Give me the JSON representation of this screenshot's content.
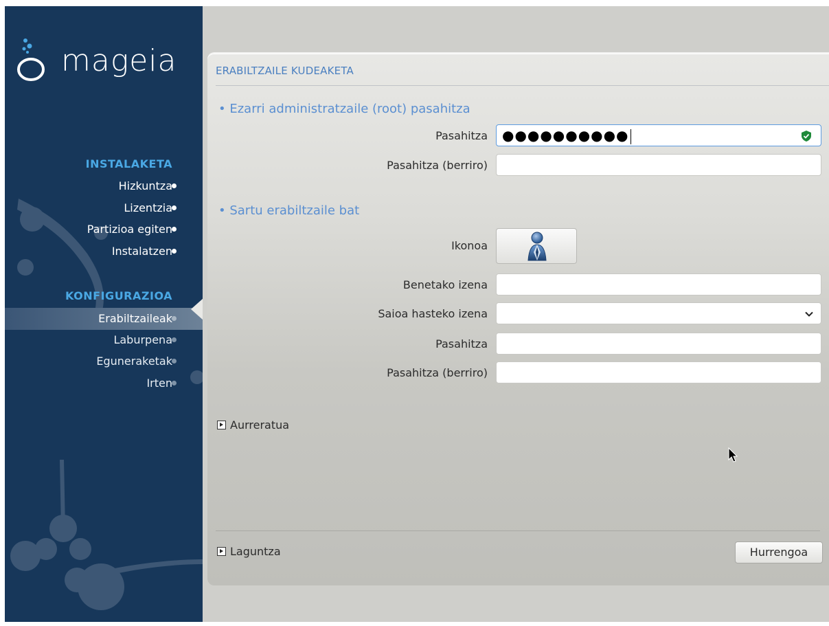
{
  "logo": {
    "text": "mageia"
  },
  "sidebar": {
    "install_title": "INSTALAKETA",
    "install_items": [
      {
        "label": "Hizkuntza"
      },
      {
        "label": "Lizentzia"
      },
      {
        "label": "Partizioa egiten"
      },
      {
        "label": "Instalatzen"
      }
    ],
    "config_title": "KONFIGURAZIOA",
    "config_items": [
      {
        "label": "Erabiltzaileak",
        "active": true
      },
      {
        "label": "Laburpena"
      },
      {
        "label": "Eguneraketak"
      },
      {
        "label": "Irten"
      }
    ]
  },
  "panel": {
    "title": "ERABILTZAILE KUDEAKETA",
    "root_section": {
      "heading": "• Ezarri administratzaile (root) pasahitza",
      "password_label": "Pasahitza",
      "password_value": "●●●●●●●●●●",
      "password_repeat_label": "Pasahitza (berriro)",
      "password_repeat_value": ""
    },
    "user_section": {
      "heading": "• Sartu erabiltzaile bat",
      "icon_label": "Ikonoa",
      "real_name_label": "Benetako izena",
      "real_name_value": "",
      "login_label": "Saioa hasteko izena",
      "login_value": "",
      "password_label": "Pasahitza",
      "password_value": "",
      "password_repeat_label": "Pasahitza (berriro)",
      "password_repeat_value": ""
    },
    "advanced_label": "Aurreratua",
    "help_label": "Laguntza",
    "next_label": "Hurrengoa"
  },
  "colors": {
    "sidebar_bg": "#17375a",
    "section_title": "#4aa8e4",
    "heading_blue": "#5b8fd1",
    "focus_border": "#5d9be0"
  },
  "icons": [
    "shield-icon",
    "user-icon",
    "chevron-down-icon",
    "expand-arrow-icon",
    "cursor-icon"
  ]
}
